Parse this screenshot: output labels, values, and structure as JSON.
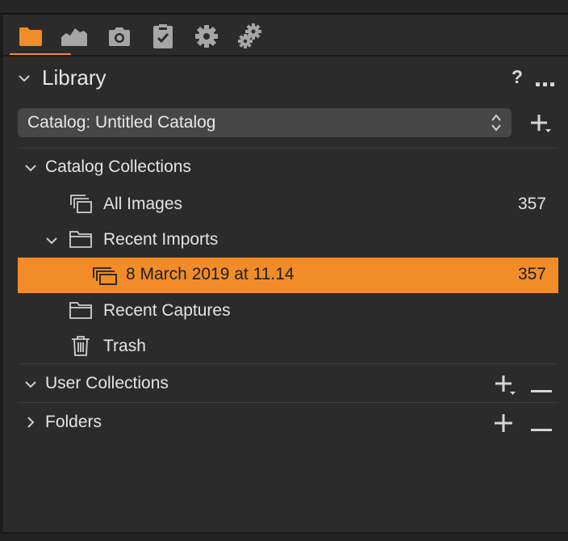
{
  "toolbar": {
    "tools": [
      {
        "icon": "folder-icon",
        "active": true
      },
      {
        "icon": "histogram-icon",
        "active": false
      },
      {
        "icon": "camera-icon",
        "active": false
      },
      {
        "icon": "clipboard-check-icon",
        "active": false
      },
      {
        "icon": "gear-icon",
        "active": false
      },
      {
        "icon": "gears-icon",
        "active": false
      }
    ],
    "accent": "#f28c28"
  },
  "library": {
    "title": "Library",
    "help": "?",
    "catalog_select": "Catalog: Untitled Catalog"
  },
  "catalog_collections": {
    "title": "Catalog Collections",
    "items": [
      {
        "label": "All Images",
        "count": "357",
        "icon": "stacked-images-icon"
      },
      {
        "label": "Recent Imports",
        "icon": "folder-outline-icon"
      },
      {
        "label": "8 March 2019 at 11.14",
        "count": "357",
        "icon": "stacked-images-icon",
        "selected": true
      },
      {
        "label": "Recent Captures",
        "icon": "folder-outline-icon"
      },
      {
        "label": "Trash",
        "icon": "trash-icon"
      }
    ]
  },
  "user_collections": {
    "title": "User Collections"
  },
  "folders": {
    "title": "Folders"
  },
  "colors": {
    "background": "#2b2b2b",
    "selection": "#f28c28",
    "text": "#e4e4e4"
  }
}
